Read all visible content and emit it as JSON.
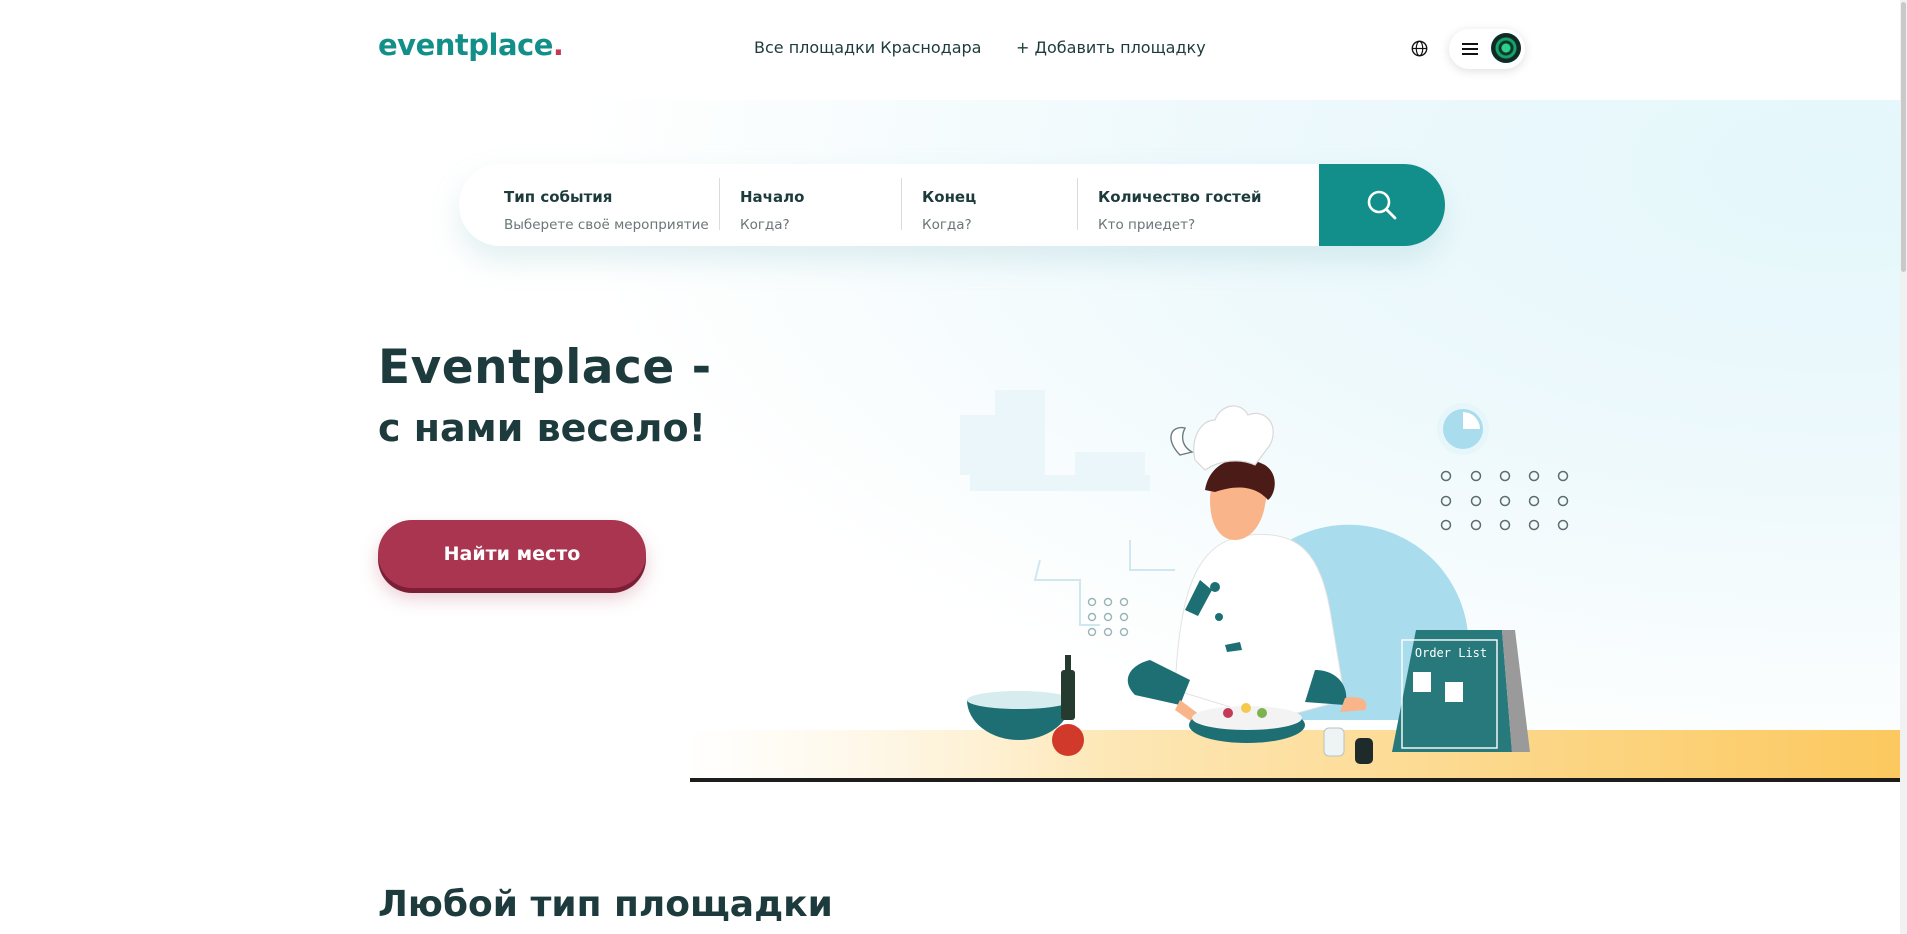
{
  "header": {
    "logo_text": "eventplace",
    "logo_dot": ".",
    "nav": {
      "all_venues": "Все площадки Краснодара",
      "add_venue": "+ Добавить площадку"
    }
  },
  "search": {
    "fields": [
      {
        "label": "Тип события",
        "placeholder": "Выберете своё мероприятие"
      },
      {
        "label": "Начало",
        "placeholder": "Когда?"
      },
      {
        "label": "Конец",
        "placeholder": "Когда?"
      },
      {
        "label": "Количество гостей",
        "placeholder": "Кто приедет?"
      }
    ]
  },
  "hero": {
    "title": "Eventplace -",
    "subtitle": "с нами весело!",
    "cta_label": "Найти место",
    "order_list_text": "Order List"
  },
  "section": {
    "title": "Любой тип площадки"
  },
  "colors": {
    "brand_teal": "#128f8b",
    "brand_crimson": "#aa3550",
    "text_dark": "#1d3b3d"
  }
}
